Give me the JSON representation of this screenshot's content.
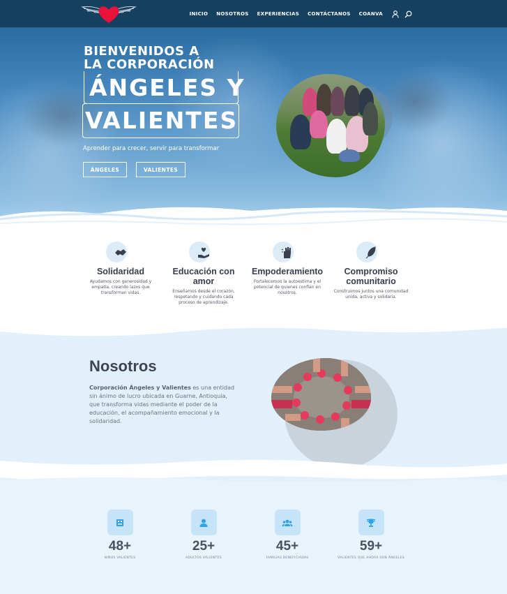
{
  "header": {
    "nav": [
      "INICIO",
      "NOSOTROS",
      "EXPERIENCIAS",
      "CONTÁCTANOS",
      "COANVA"
    ],
    "icons": [
      "user-icon",
      "search-icon"
    ],
    "colors": {
      "bar": "#15405f",
      "heart": "#e8123a"
    }
  },
  "hero": {
    "line1": "BIENVENIDOS A",
    "line2": "LA CORPORACIÓN",
    "big1": "ÁNGELES Y",
    "big2": "VALIENTES",
    "subtitle": "Aprender para crecer, servir para transformar",
    "buttons": [
      "ÁNGELES",
      "VALIENTES"
    ]
  },
  "values": [
    {
      "icon": "handshake-icon",
      "title": "Solidaridad",
      "text": "Ayudamos con generosidad y empatía, creando lazos que transforman vidas."
    },
    {
      "icon": "heart-hand-icon",
      "title": "Educación con amor",
      "text": "Enseñamos desde el corazón, respetando y cuidando cada proceso de aprendizaje."
    },
    {
      "icon": "raised-hand-icon",
      "title": "Empoderamiento",
      "text": "Fortalecemos la autoestima y el potencial de quienes confían en nosotros."
    },
    {
      "icon": "feather-icon",
      "title": "Compromiso comunitario",
      "text": "Construimos juntos una comunidad unida, activa y solidaria."
    }
  ],
  "nosotros": {
    "title": "Nosotros",
    "bold": "Corporación Ángeles y Valientes",
    "text": " es una entidad sin ánimo de lucro ubicada en Guarne, Antioquia, que transforma vidas mediante el poder de la educación, el acompañamiento emocional y la solidaridad."
  },
  "stats": [
    {
      "icon": "child-icon",
      "value": "48+",
      "label": "NIÑOS VALIENTES"
    },
    {
      "icon": "person-icon",
      "value": "25+",
      "label": "ADULTOS VALIENTES"
    },
    {
      "icon": "group-icon",
      "value": "45+",
      "label": "FAMILIAS BENEFICIADAS"
    },
    {
      "icon": "trophy-icon",
      "value": "59+",
      "label": "VALIENTES QUE AHORA SON ÁNGELES"
    }
  ]
}
